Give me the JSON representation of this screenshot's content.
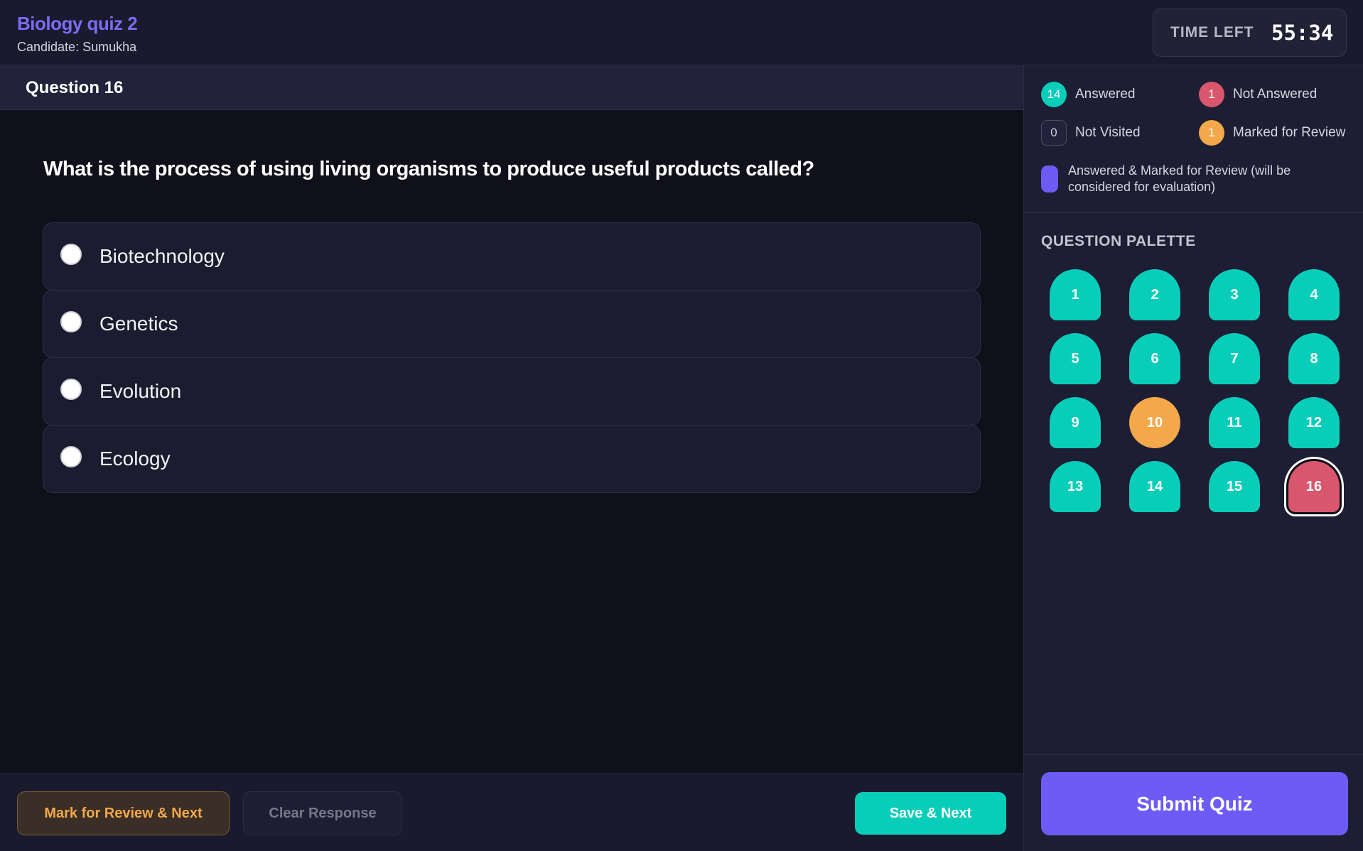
{
  "header": {
    "quiz_title": "Biology quiz 2",
    "candidate": "Candidate: Sumukha",
    "timer_label": "TIME LEFT",
    "timer_value": "55:34"
  },
  "question": {
    "number_label": "Question 16",
    "text": "What is the process of using living organisms to produce useful products called?",
    "options": [
      {
        "label": "Biotechnology",
        "selected": false
      },
      {
        "label": "Genetics",
        "selected": false
      },
      {
        "label": "Evolution",
        "selected": false
      },
      {
        "label": "Ecology",
        "selected": false
      }
    ]
  },
  "actions": {
    "mark_review_label": "Mark for Review & Next",
    "clear_label": "Clear Response",
    "save_next_label": "Save & Next"
  },
  "legend": {
    "answered": {
      "count": "14",
      "label": "Answered"
    },
    "not_answered": {
      "count": "1",
      "label": "Not Answered"
    },
    "not_visited": {
      "count": "0",
      "label": "Not Visited"
    },
    "marked_review": {
      "count": "1",
      "label": "Marked for Review"
    },
    "answered_marked": {
      "label": "Answered & Marked for Review (will be considered for evaluation)"
    }
  },
  "palette": {
    "title": "QUESTION PALETTE",
    "current": 16,
    "items": [
      {
        "num": "1",
        "status": "answered"
      },
      {
        "num": "2",
        "status": "answered"
      },
      {
        "num": "3",
        "status": "answered"
      },
      {
        "num": "4",
        "status": "answered"
      },
      {
        "num": "5",
        "status": "answered"
      },
      {
        "num": "6",
        "status": "answered"
      },
      {
        "num": "7",
        "status": "answered"
      },
      {
        "num": "8",
        "status": "answered"
      },
      {
        "num": "9",
        "status": "answered"
      },
      {
        "num": "10",
        "status": "review"
      },
      {
        "num": "11",
        "status": "answered"
      },
      {
        "num": "12",
        "status": "answered"
      },
      {
        "num": "13",
        "status": "answered"
      },
      {
        "num": "14",
        "status": "answered"
      },
      {
        "num": "15",
        "status": "answered"
      },
      {
        "num": "16",
        "status": "notanswered"
      }
    ]
  },
  "submit_label": "Submit Quiz",
  "colors": {
    "accent": "#6c5cf5",
    "answered": "#08cdb8",
    "not_answered": "#d9576c",
    "review": "#f3a84a"
  }
}
